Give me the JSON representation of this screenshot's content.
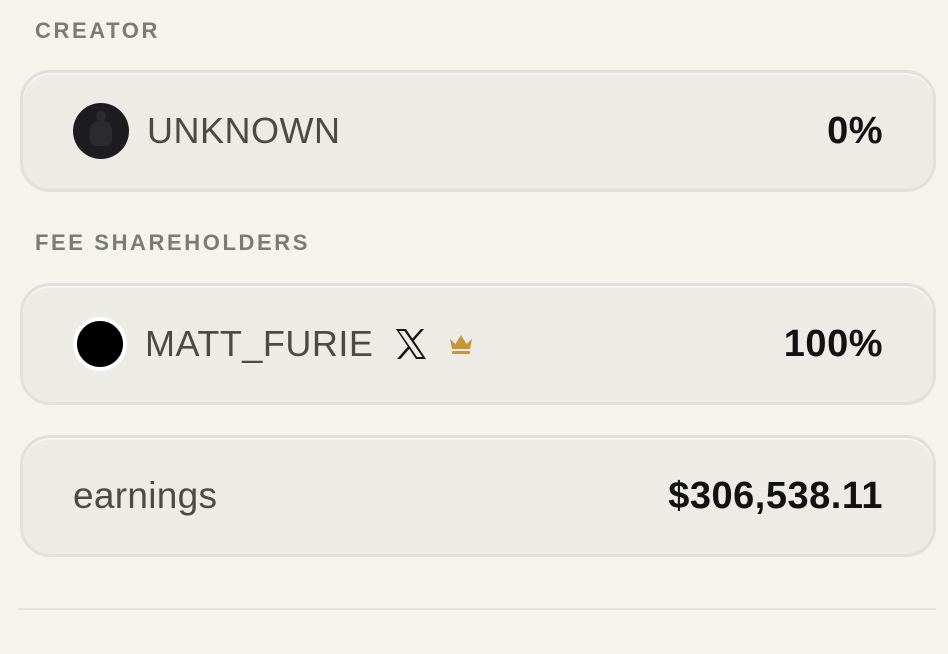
{
  "creator_section": {
    "label": "CREATOR",
    "name": "UNKNOWN",
    "percent": "0%",
    "avatar_icon": "unknown-user-avatar"
  },
  "shareholders_section": {
    "label": "FEE SHAREHOLDERS",
    "name": "MATT_FURIE",
    "percent": "100%",
    "avatar_icon": "matt-furie-avatar",
    "badges": [
      "x-logo-icon",
      "crown-icon"
    ],
    "crown_color": "#c8953a"
  },
  "earnings": {
    "label": "earnings",
    "value": "$306,538.11"
  },
  "colors": {
    "background": "#f4f3ec",
    "card": "#ecebe5",
    "card_border": "#e1e0da",
    "label": "#7b7a74",
    "value": "#121212"
  }
}
